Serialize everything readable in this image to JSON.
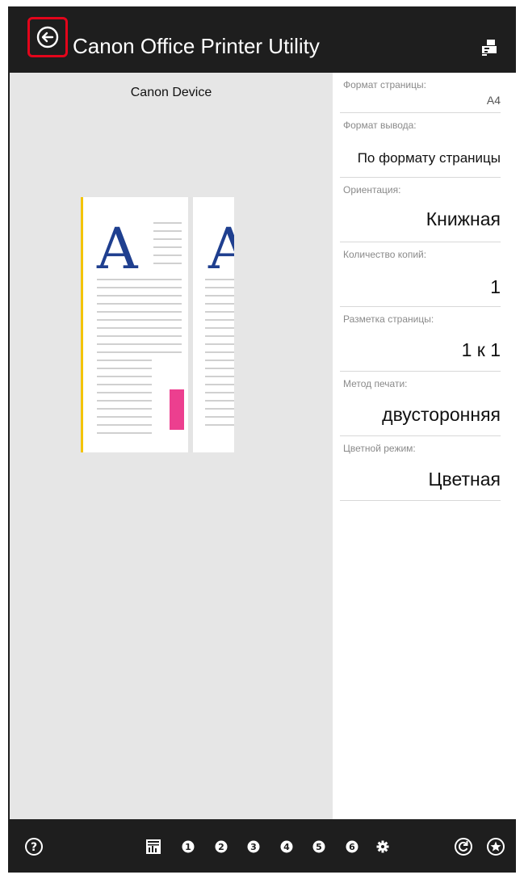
{
  "header": {
    "title": "Canon Office Printer Utility",
    "back_icon": "back-arrow-circle-icon",
    "device_icon": "printer-device-icon"
  },
  "preview": {
    "device_name": "Canon Device",
    "page_glyph": "A"
  },
  "settings": [
    {
      "label": "Формат страницы:",
      "value": "A4"
    },
    {
      "label": "Формат вывода:",
      "value": "По формату страницы"
    },
    {
      "label": "Ориентация:",
      "value": "Книжная"
    },
    {
      "label": "Количество копий:",
      "value": "1"
    },
    {
      "label": "Разметка страницы:",
      "value": "1 к 1"
    },
    {
      "label": "Метод печати:",
      "value": "двусторонняя"
    },
    {
      "label": "Цветной режим:",
      "value": "Цветная"
    }
  ],
  "bottombar": {
    "help_icon": "help-question-icon",
    "layout_icon": "print-layout-icon",
    "favorites": [
      "1",
      "2",
      "3",
      "4",
      "5",
      "6"
    ],
    "settings_icon": "gear-icon",
    "reset_icon": "reset-icon",
    "favorite_icon": "star-icon"
  },
  "colors": {
    "bar_bg": "#1e1e1e",
    "highlight": "#e3051b",
    "accent_yellow": "#f3c400",
    "accent_magenta": "#ec3f8f",
    "glyph_blue": "#1f3f8f"
  }
}
